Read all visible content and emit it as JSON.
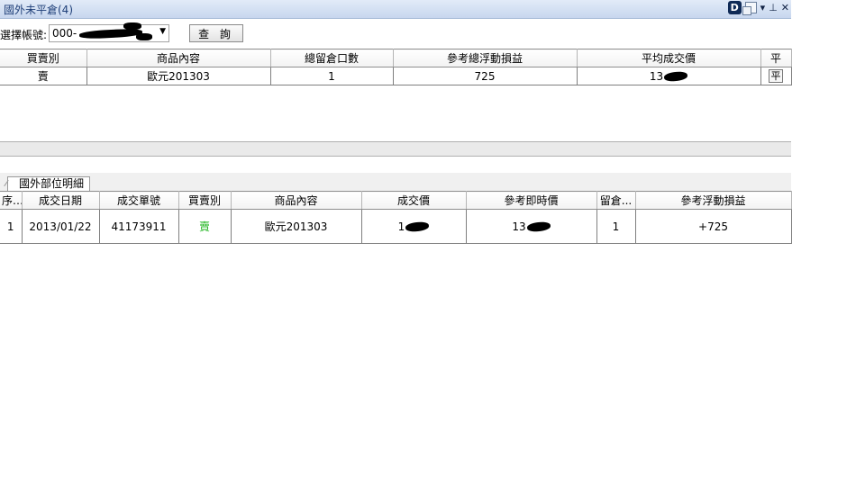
{
  "window": {
    "title": "國外未平倉(4)",
    "icons": {
      "d_logo": "D",
      "restore": "restore-icon",
      "menu": "▾",
      "pin": "⊥",
      "close": "✕"
    }
  },
  "toolbar": {
    "account_label": "選擇帳號:",
    "account_value": "000-",
    "query_button": "查 詢"
  },
  "positions_table": {
    "columns": [
      "買賣別",
      "商品內容",
      "總留倉口數",
      "參考總浮動損益",
      "平均成交價",
      "平"
    ],
    "rows": [
      {
        "side": "賣",
        "product": "歐元201303",
        "open_qty": "1",
        "float_pnl": "725",
        "avg_price": "13",
        "close_label": "平"
      }
    ]
  },
  "detail_tab": {
    "label": "國外部位明細"
  },
  "detail_table": {
    "columns": [
      "序...",
      "成交日期",
      "成交單號",
      "買賣別",
      "商品內容",
      "成交價",
      "參考即時價",
      "留倉...",
      "參考浮動損益"
    ],
    "rows": [
      {
        "seq": "1",
        "date": "2013/01/22",
        "order_no": "41173911",
        "side": "賣",
        "product": "歐元201303",
        "trade_price": "1",
        "ref_price": "13",
        "open_qty": "1",
        "float_pnl": "+725"
      }
    ]
  },
  "colors": {
    "sell_side": "#1fb41f",
    "title_text": "#1f3f78"
  }
}
